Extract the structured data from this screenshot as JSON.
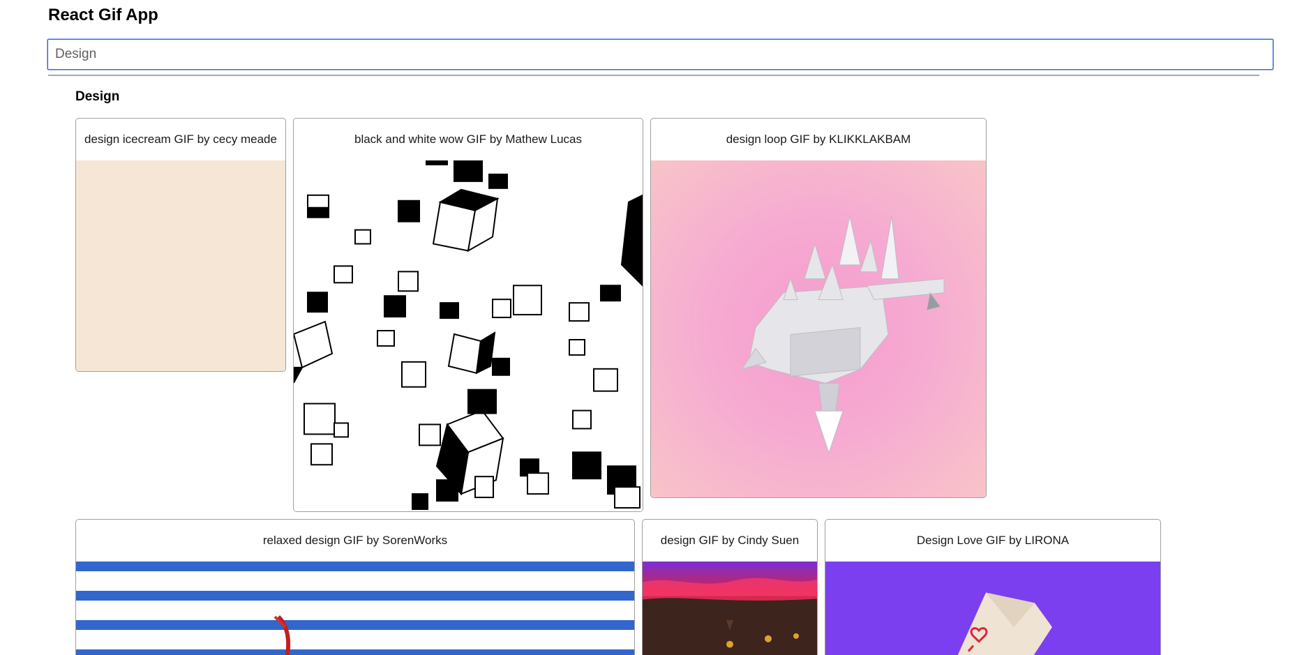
{
  "app": {
    "title": "React Gif App"
  },
  "search": {
    "value": "Design",
    "placeholder": ""
  },
  "category": {
    "title": "Design"
  },
  "gifs": [
    {
      "title": "design icecream GIF by cecy meade",
      "background": "#f6e6d6",
      "icon": "gif-image"
    },
    {
      "title": "black and white wow GIF by Mathew Lucas",
      "background": "#ffffff",
      "icon": "gif-image"
    },
    {
      "title": "design loop GIF by KLIKKLAKBAM",
      "background": "#f6aad2",
      "icon": "gif-image"
    },
    {
      "title": "relaxed design GIF by SorenWorks",
      "background": "#3366cc",
      "icon": "gif-image"
    },
    {
      "title": "design GIF by Cindy Suen",
      "background": "#2e1a14",
      "icon": "gif-image"
    },
    {
      "title": "Design Love GIF by LIRONA",
      "background": "#7b3ff0",
      "icon": "gif-image"
    }
  ],
  "colors": {
    "input_focus_border": "#3367d6",
    "card_border": "#9f9f9f",
    "divider": "#a8a8a8"
  }
}
